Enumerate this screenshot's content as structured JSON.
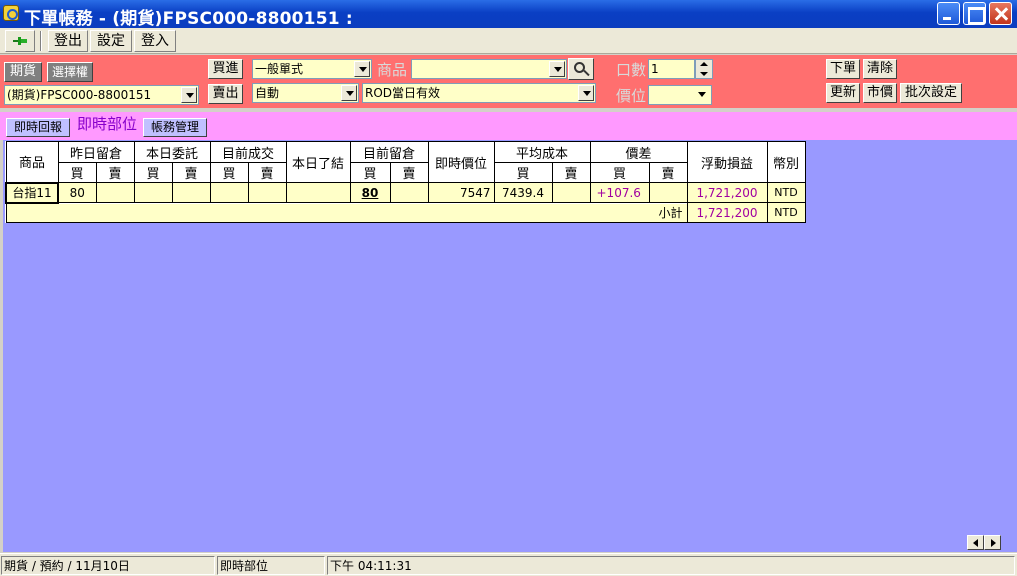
{
  "window": {
    "title": "下單帳務 - (期貨)FPSC000-8800151 :"
  },
  "toolbar": {
    "logout_label": "登出",
    "settings_label": "設定",
    "login_label": "登入"
  },
  "order_panel": {
    "futures_label": "期貨",
    "options_label": "選擇權",
    "account_value": "(期貨)FPSC000-8800151",
    "buy_label": "買進",
    "sell_label": "賣出",
    "order_type_value": "一般單式",
    "offset_value": "自動",
    "product_label": "商品",
    "product_value": "",
    "condition_value": "ROD當日有效",
    "qty_label": "口數",
    "qty_value": "1",
    "price_label": "價位",
    "price_value": "",
    "place_order_label": "下單",
    "clear_label": "清除",
    "update_label": "更新",
    "market_price_label": "市價",
    "batch_settings_label": "批次設定"
  },
  "tabs": [
    {
      "label": "即時回報",
      "active": false
    },
    {
      "label": "即時部位",
      "active": true
    },
    {
      "label": "帳務管理",
      "active": false
    }
  ],
  "table": {
    "headers": {
      "product": "商品",
      "prev_position": "昨日留倉",
      "today_orders": "本日委託",
      "current_trades": "目前成交",
      "today_closed": "本日了結",
      "current_position": "目前留倉",
      "live_price": "即時價位",
      "avg_cost": "平均成本",
      "price_diff": "價差",
      "floating_pnl": "浮動損益",
      "currency": "幣別",
      "buy": "買",
      "sell": "賣"
    },
    "rows": [
      {
        "product": "台指11",
        "prev_buy": "80",
        "prev_sell": "",
        "orders_buy": "",
        "orders_sell": "",
        "trades_buy": "",
        "trades_sell": "",
        "closed": "",
        "pos_buy": "80",
        "pos_sell": "",
        "live_price": "7547",
        "cost_buy": "7439.4",
        "cost_sell": "",
        "diff_buy": "+107.6",
        "diff_sell": "",
        "pnl": "1,721,200",
        "currency": "NTD"
      }
    ],
    "subtotal": {
      "label": "小計",
      "pnl": "1,721,200",
      "currency": "NTD"
    }
  },
  "statusbar": {
    "session": "期貨 / 預約 / 11月10日",
    "view": "即時部位",
    "time": "下午 04:11:31"
  },
  "colors": {
    "title_bar": "#0b3dbf",
    "order_panel": "#ff6f6f",
    "tab_strip": "#ff99ff",
    "content_bg": "#9999ff",
    "row_bg": "#ffffc8",
    "profit_text": "#a000a0"
  }
}
